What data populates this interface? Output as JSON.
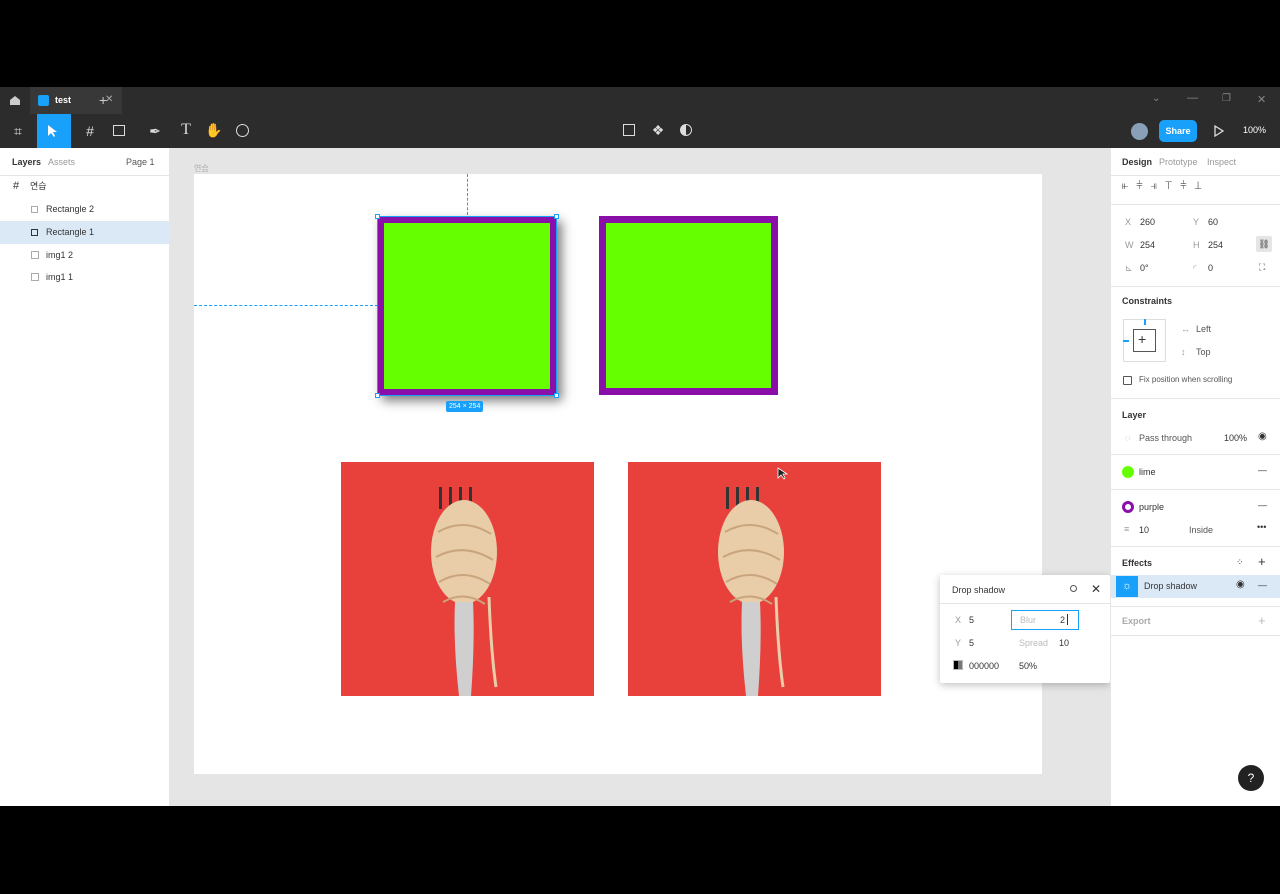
{
  "tabbar": {
    "tab_title": "test"
  },
  "toolbar": {
    "share_label": "Share",
    "zoom": "100%"
  },
  "left_panel": {
    "tabs": {
      "layers": "Layers",
      "assets": "Assets"
    },
    "page": "Page 1",
    "frame_name": "연습",
    "layers": [
      "Rectangle 2",
      "Rectangle 1",
      "img1 2",
      "img1 1"
    ]
  },
  "canvas": {
    "frame_label": "연습",
    "size_badge": "254 × 254"
  },
  "right_panel": {
    "tabs": {
      "design": "Design",
      "prototype": "Prototype",
      "inspect": "Inspect"
    },
    "x_label": "X",
    "x": "260",
    "y_label": "Y",
    "y": "60",
    "w_label": "W",
    "w": "254",
    "h_label": "H",
    "h": "254",
    "rotation": "0°",
    "radius": "0",
    "constraints_title": "Constraints",
    "constraint_h": "Left",
    "constraint_v": "Top",
    "fix_position": "Fix position when scrolling",
    "layer_title": "Layer",
    "blend": "Pass through",
    "opacity": "100%",
    "fill_name": "lime",
    "stroke_name": "purple",
    "stroke_weight": "10",
    "stroke_align": "Inside",
    "effects_title": "Effects",
    "effect_name": "Drop shadow",
    "export_title": "Export"
  },
  "shadow_popup": {
    "title": "Drop shadow",
    "x_label": "X",
    "x": "5",
    "y_label": "Y",
    "y": "5",
    "blur_label": "Blur",
    "blur_value": "2",
    "spread_label": "Spread",
    "spread": "10",
    "color": "000000",
    "opacity": "50%"
  },
  "colors": {
    "accent": "#18a0fb",
    "lime": "#66ff00",
    "purple": "#8a0fa8",
    "photo_red": "#e8403b"
  }
}
